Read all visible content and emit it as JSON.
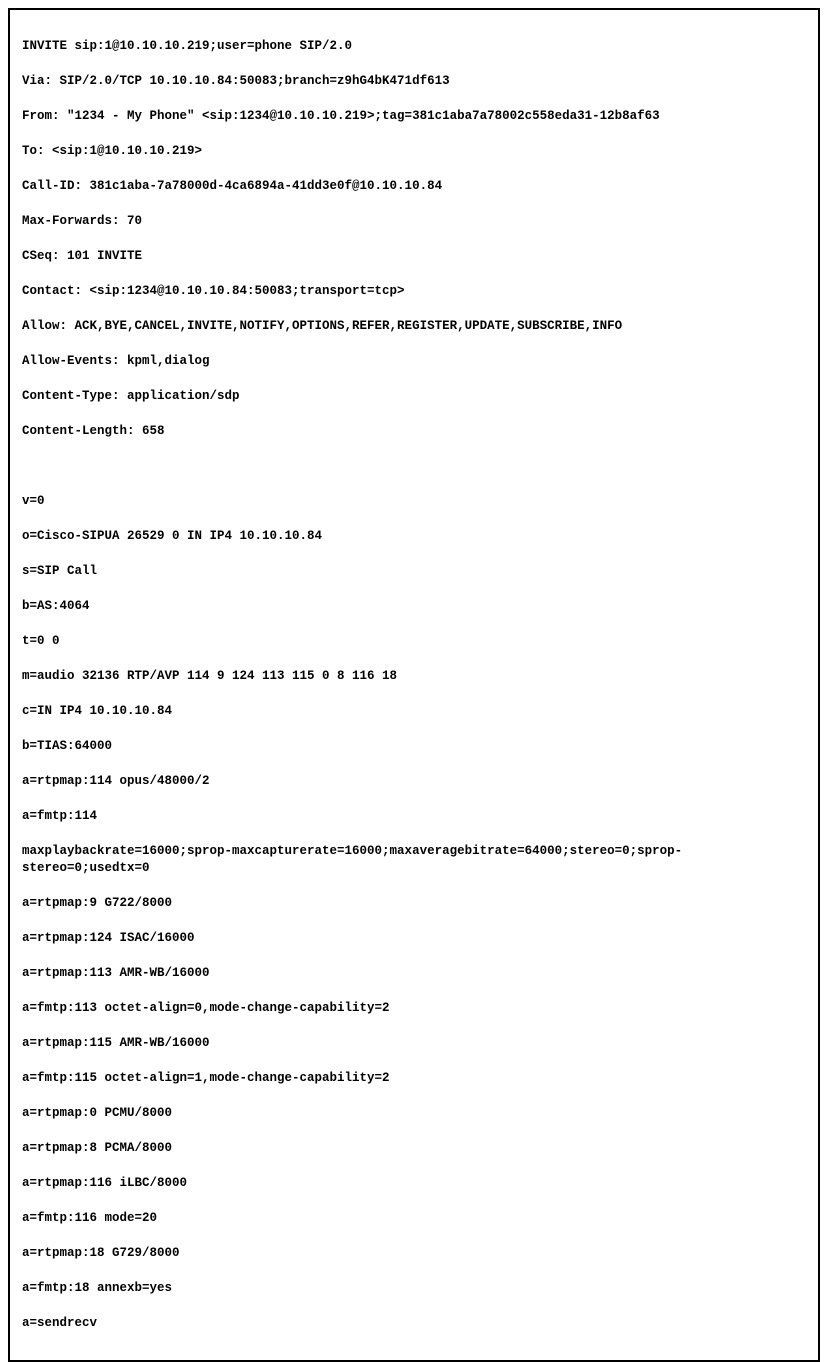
{
  "sip": {
    "request_line": "INVITE sip:1@10.10.10.219;user=phone SIP/2.0",
    "via": "Via: SIP/2.0/TCP 10.10.10.84:50083;branch=z9hG4bK471df613",
    "from": "From: \"1234 - My Phone\" <sip:1234@10.10.10.219>;tag=381c1aba7a78002c558eda31-12b8af63",
    "to": "To: <sip:1@10.10.10.219>",
    "call_id": "Call-ID: 381c1aba-7a78000d-4ca6894a-41dd3e0f@10.10.10.84",
    "max_forwards": "Max-Forwards: 70",
    "cseq": "CSeq: 101 INVITE",
    "contact": "Contact: <sip:1234@10.10.10.84:50083;transport=tcp>",
    "allow": "Allow: ACK,BYE,CANCEL,INVITE,NOTIFY,OPTIONS,REFER,REGISTER,UPDATE,SUBSCRIBE,INFO",
    "allow_events": "Allow-Events: kpml,dialog",
    "content_type": "Content-Type: application/sdp",
    "content_length": "Content-Length: 658"
  },
  "sdp": {
    "v": "v=0",
    "o": "o=Cisco-SIPUA 26529 0 IN IP4 10.10.10.84",
    "s": "s=SIP Call",
    "b_as": "b=AS:4064",
    "t": "t=0 0",
    "m": "m=audio 32136 RTP/AVP 114 9 124 113 115 0 8 116 18",
    "c": "c=IN IP4 10.10.10.84",
    "b_tias": "b=TIAS:64000",
    "rtpmap114": "a=rtpmap:114 opus/48000/2",
    "fmtp114": "a=fmtp:114",
    "fmtp114_params": "maxplaybackrate=16000;sprop-maxcapturerate=16000;maxaveragebitrate=64000;stereo=0;sprop-stereo=0;usedtx=0",
    "rtpmap9": "a=rtpmap:9 G722/8000",
    "rtpmap124": "a=rtpmap:124 ISAC/16000",
    "rtpmap113": "a=rtpmap:113 AMR-WB/16000",
    "fmtp113": "a=fmtp:113 octet-align=0,mode-change-capability=2",
    "rtpmap115": "a=rtpmap:115 AMR-WB/16000",
    "fmtp115": "a=fmtp:115 octet-align=1,mode-change-capability=2",
    "rtpmap0": "a=rtpmap:0 PCMU/8000",
    "rtpmap8": "a=rtpmap:8 PCMA/8000",
    "rtpmap116": "a=rtpmap:116 iLBC/8000",
    "fmtp116": "a=fmtp:116 mode=20",
    "rtpmap18": "a=rtpmap:18 G729/8000",
    "fmtp18": "a=fmtp:18 annexb=yes",
    "sendrecv": "a=sendrecv"
  }
}
